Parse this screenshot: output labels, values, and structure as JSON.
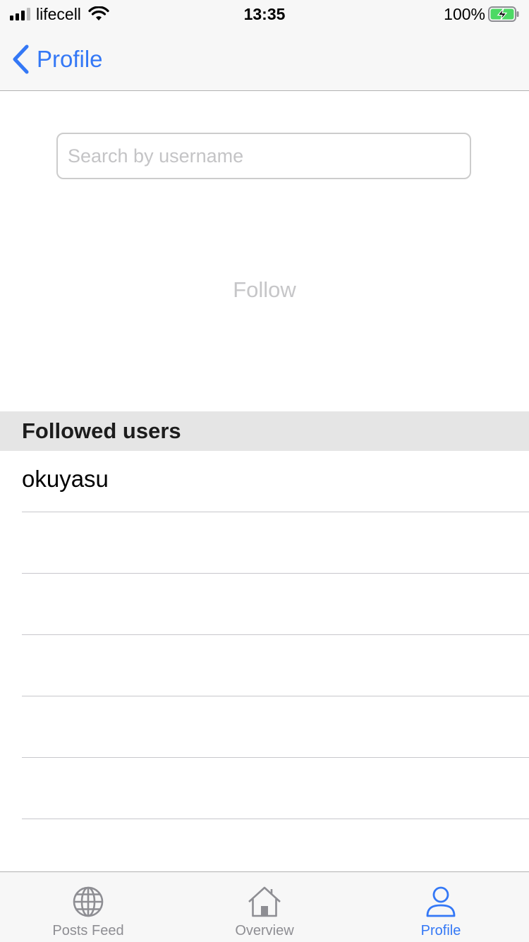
{
  "status_bar": {
    "carrier": "lifecell",
    "time": "13:35",
    "battery_percent": "100%",
    "signal_bars": 3,
    "signal_bars_total": 4,
    "battery_level": 1.0,
    "battery_fill_color": "#4cd964"
  },
  "nav": {
    "back_label": "Profile",
    "accent_color": "#3478f6",
    "back_icon": "chevron-left-icon"
  },
  "search": {
    "value": "",
    "placeholder": "Search by username"
  },
  "follow": {
    "label": "Follow",
    "enabled": false
  },
  "followed_section": {
    "title": "Followed users",
    "users": [
      "okuyasu",
      "",
      "",
      "",
      "",
      ""
    ]
  },
  "tab_bar": {
    "active_color": "#3478f6",
    "inactive_color": "#8e8e93",
    "tabs": [
      {
        "label": "Posts Feed",
        "icon": "globe-icon",
        "active": false
      },
      {
        "label": "Overview",
        "icon": "house-icon",
        "active": false
      },
      {
        "label": "Profile",
        "icon": "person-icon",
        "active": true
      }
    ]
  }
}
